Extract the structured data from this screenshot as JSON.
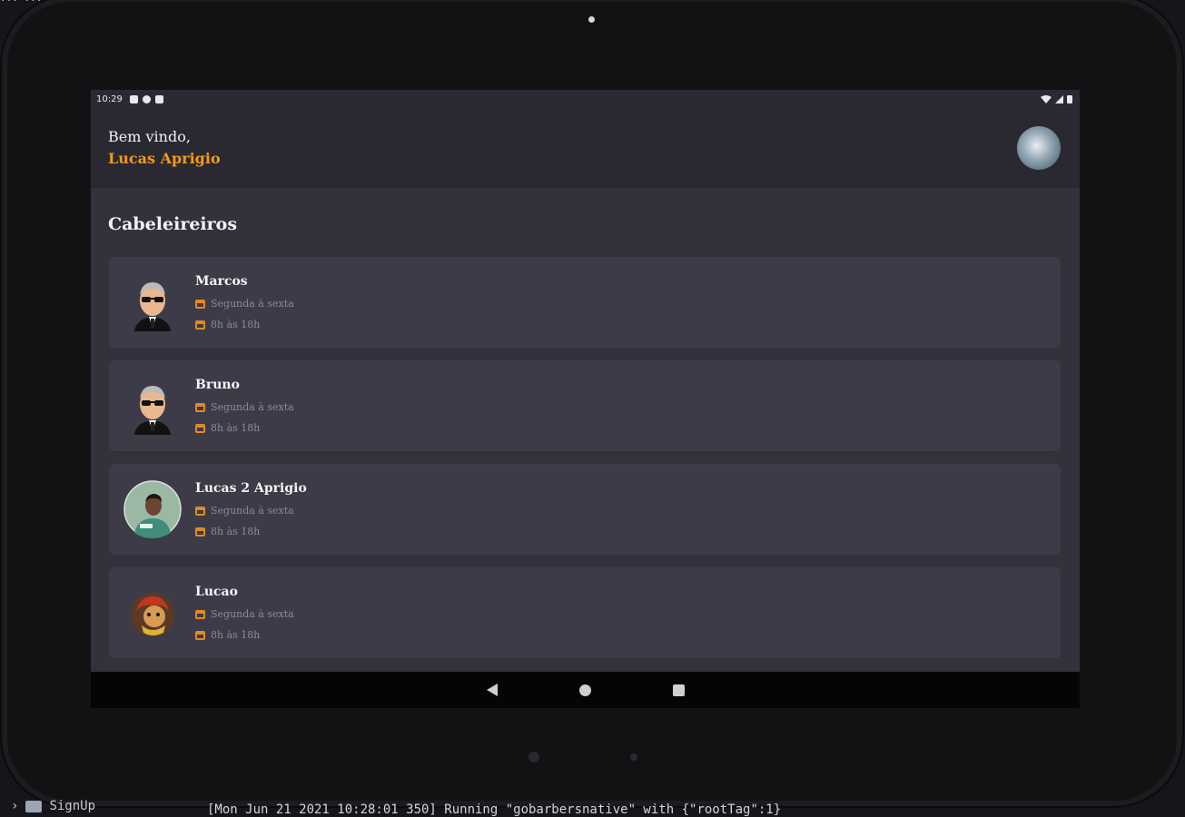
{
  "status_bar": {
    "time": "10:29"
  },
  "header": {
    "greeting": "Bem vindo,",
    "user_name": "Lucas Aprigio"
  },
  "section": {
    "title": "Cabeleireiros"
  },
  "barbers": [
    {
      "name": "Marcos",
      "days": "Segunda à sexta",
      "hours": "8h às 18h",
      "avatar_icon": "cartoon-barber-avatar"
    },
    {
      "name": "Bruno",
      "days": "Segunda à sexta",
      "hours": "8h às 18h",
      "avatar_icon": "cartoon-barber-avatar"
    },
    {
      "name": "Lucas 2 Aprigio",
      "days": "Segunda à sexta",
      "hours": "8h às 18h",
      "avatar_icon": "photo-avatar"
    },
    {
      "name": "Lucao",
      "days": "Segunda à sexta",
      "hours": "8h às 18h",
      "avatar_icon": "game-character-avatar"
    }
  ],
  "desktop": {
    "folder_label": "SignUp",
    "log_text": "[Mon Jun 21 2021 10:28:01 350]      Running \"gobarbersnative\" with {\"rootTag\":1}"
  },
  "colors": {
    "accent": "#f19a1c",
    "card": "#3d3b47",
    "background": "#33313c"
  }
}
